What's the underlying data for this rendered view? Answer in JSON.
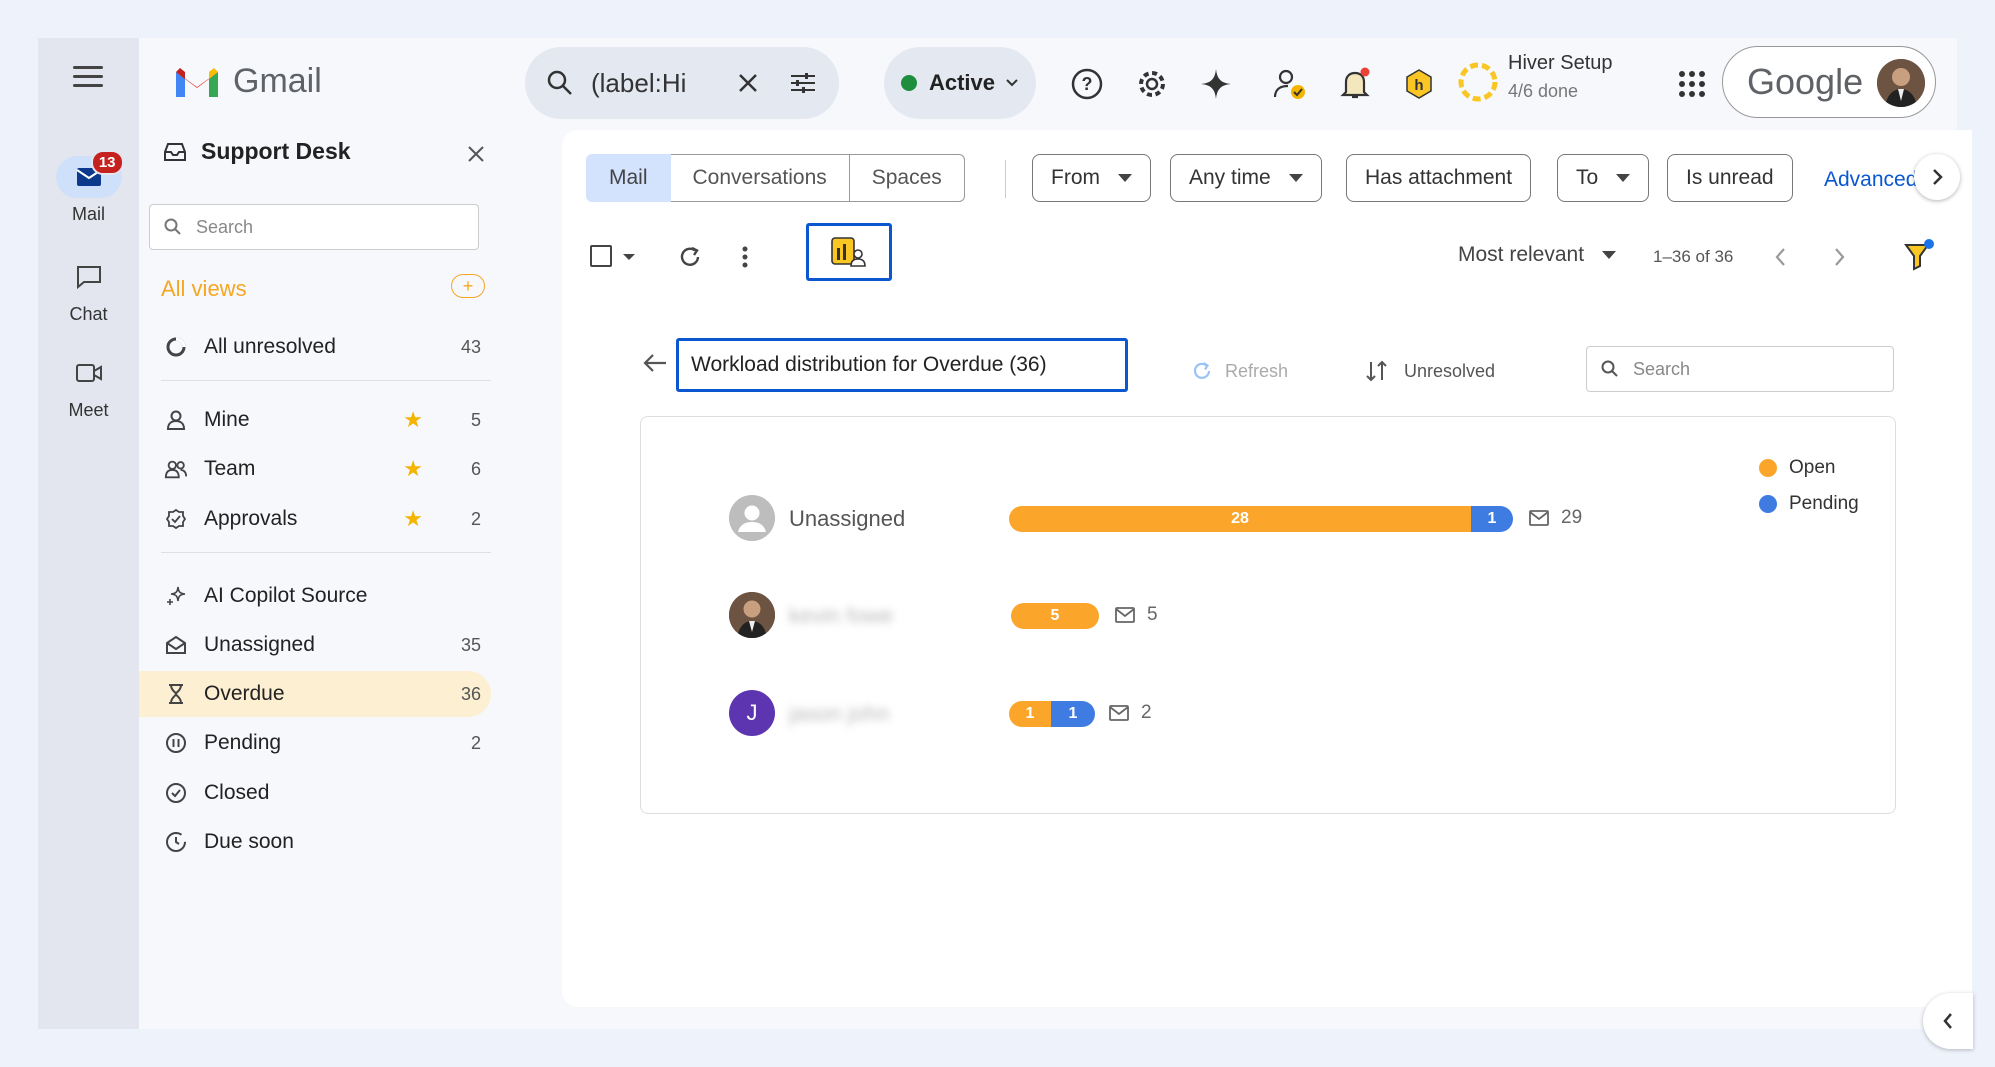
{
  "app": {
    "name": "Gmail"
  },
  "rail": {
    "items": [
      {
        "label": "Mail",
        "badge": "13"
      },
      {
        "label": "Chat"
      },
      {
        "label": "Meet"
      }
    ]
  },
  "search": {
    "query": "(label:Hi"
  },
  "status": {
    "label": "Active"
  },
  "hiver": {
    "title": "Hiver Setup",
    "progress": "4/6 done",
    "progress_fraction": 0.67
  },
  "account": {
    "brand": "Google"
  },
  "panel": {
    "title": "Support Desk",
    "search_placeholder": "Search",
    "all_views_label": "All views",
    "add_label": "+",
    "items": [
      {
        "label": "All unresolved",
        "count": "43",
        "icon": "circle-progress-icon"
      },
      {
        "label": "Mine",
        "count": "5",
        "starred": true,
        "icon": "person-icon"
      },
      {
        "label": "Team",
        "count": "6",
        "starred": true,
        "icon": "people-icon"
      },
      {
        "label": "Approvals",
        "count": "2",
        "starred": true,
        "icon": "approval-icon"
      },
      {
        "label": "AI Copilot Source",
        "count": "",
        "icon": "sparkle-icon"
      },
      {
        "label": "Unassigned",
        "count": "35",
        "icon": "envelope-open-icon"
      },
      {
        "label": "Overdue",
        "count": "36",
        "icon": "hourglass-icon",
        "active": true
      },
      {
        "label": "Pending",
        "count": "2",
        "icon": "pause-icon"
      },
      {
        "label": "Closed",
        "count": "",
        "icon": "check-circle-icon"
      },
      {
        "label": "Due soon",
        "count": "",
        "icon": "clock-icon"
      }
    ],
    "star_glyph": "★"
  },
  "tabs": [
    "Mail",
    "Conversations",
    "Spaces"
  ],
  "filters": {
    "from": "From",
    "any_time": "Any time",
    "has_attachment": "Has attachment",
    "to": "To",
    "is_unread": "Is unread",
    "advanced": "Advanced search"
  },
  "toolbar": {
    "sort": "Most relevant",
    "range": "1–36 of 36"
  },
  "workload": {
    "title": "Workload distribution for Overdue (36)",
    "refresh_label": "Refresh",
    "filter_label": "Unresolved",
    "search_placeholder": "Search",
    "legend": {
      "open": "Open",
      "pending": "Pending"
    },
    "colors": {
      "open": "#fba52b",
      "pending": "#3f7ce1"
    },
    "agents": [
      {
        "name": "Unassigned",
        "open": "28",
        "pending": "1",
        "total": "29"
      },
      {
        "name": "kevin fowe",
        "open": "5",
        "pending": "",
        "total": "5"
      },
      {
        "name": "jason john",
        "initial": "J",
        "open": "1",
        "pending": "1",
        "total": "2"
      }
    ]
  }
}
